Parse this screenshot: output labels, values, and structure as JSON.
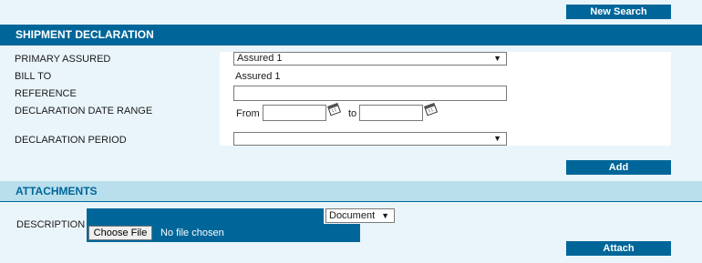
{
  "buttons": {
    "new_search": "New Search",
    "add": "Add",
    "attach": "Attach"
  },
  "shipment": {
    "title": "SHIPMENT DECLARATION",
    "primary_assured": {
      "label": "PRIMARY ASSURED",
      "value": "Assured 1"
    },
    "bill_to": {
      "label": "BILL TO",
      "value": "Assured 1"
    },
    "reference": {
      "label": "REFERENCE",
      "value": ""
    },
    "date_range": {
      "label": "DECLARATION DATE RANGE",
      "from_label": "From",
      "to_label": "to",
      "from_value": "",
      "to_value": ""
    },
    "period": {
      "label": "DECLARATION PERIOD",
      "value": ""
    }
  },
  "attachments": {
    "title": "ATTACHMENTS",
    "description_label": "DESCRIPTION",
    "doc_type": "Document",
    "choose_file": "Choose File",
    "no_file": "No file chosen"
  },
  "colors": {
    "primary": "#006699",
    "background": "#eaf5fb",
    "section_light": "#b9dfed"
  },
  "icons": {
    "calendar": "calendar-icon",
    "dropdown": "chevron-down-icon"
  }
}
